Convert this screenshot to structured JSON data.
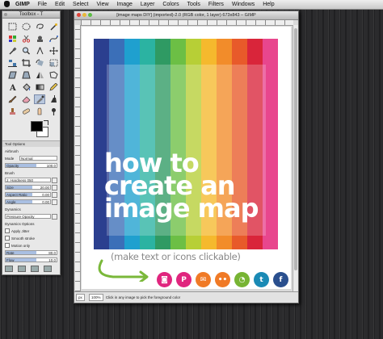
{
  "menubar": {
    "items": [
      "GIMP",
      "File",
      "Edit",
      "Select",
      "View",
      "Image",
      "Layer",
      "Colors",
      "Tools",
      "Filters",
      "Windows",
      "Help"
    ]
  },
  "toolbox": {
    "title": "Toolbox - T",
    "tool_options_label": "Tool Options",
    "tool_name": "Airbrush",
    "mode_label": "Mode",
    "mode_value": "Normal",
    "opacity_label": "Opacity",
    "opacity_value": "100.0",
    "brush_label": "Brush",
    "brush_value": "2. Hardness 050",
    "size_label": "Size",
    "size_value": "20.00",
    "aspect_label": "Aspect Ratio",
    "aspect_value": "0.00",
    "angle_label": "Angle",
    "angle_value": "0.00",
    "dynamics_label": "Dynamics",
    "dynamics_value": "Pressure Opacity",
    "dynamics_options_label": "Dynamics Options",
    "apply_jitter_label": "Apply Jitter",
    "smooth_stroke_label": "Smooth stroke",
    "motion_only_label": "Motion only",
    "rate_label": "Rate",
    "rate_value": "80.0",
    "flow_label": "Flow",
    "flow_value": "10.0"
  },
  "image_window": {
    "title": "[image maps DIY] (imported)-2.0 (RGB color, 1 layer) 673x843 – GIMP",
    "headline_line1": "how to",
    "headline_line2": "create an",
    "headline_line3": "image map",
    "subline": "(make text or icons clickable)",
    "stripe_colors": [
      "#2b3f8f",
      "#3b6fb8",
      "#1fa0cf",
      "#2bb3a2",
      "#2f9a63",
      "#6cbf45",
      "#b7cf36",
      "#f5b92d",
      "#f28c2a",
      "#e85a2a",
      "#d9253a",
      "#e8468d"
    ],
    "social_icons": [
      {
        "name": "instagram-icon",
        "glyph": "◙",
        "color": "#e0257e"
      },
      {
        "name": "pinterest-icon",
        "glyph": "P",
        "color": "#e0257e"
      },
      {
        "name": "email-icon",
        "glyph": "✉",
        "color": "#f07a26"
      },
      {
        "name": "flickr-icon",
        "glyph": "••",
        "color": "#f07a26"
      },
      {
        "name": "rss-icon",
        "glyph": "◔",
        "color": "#77b433"
      },
      {
        "name": "twitter-icon",
        "glyph": "t",
        "color": "#1a8ab5"
      },
      {
        "name": "facebook-icon",
        "glyph": "f",
        "color": "#2a4f8e"
      }
    ],
    "status_unit": "px",
    "status_zoom": "100%",
    "status_text": "Click in any image to pick the foreground color"
  }
}
